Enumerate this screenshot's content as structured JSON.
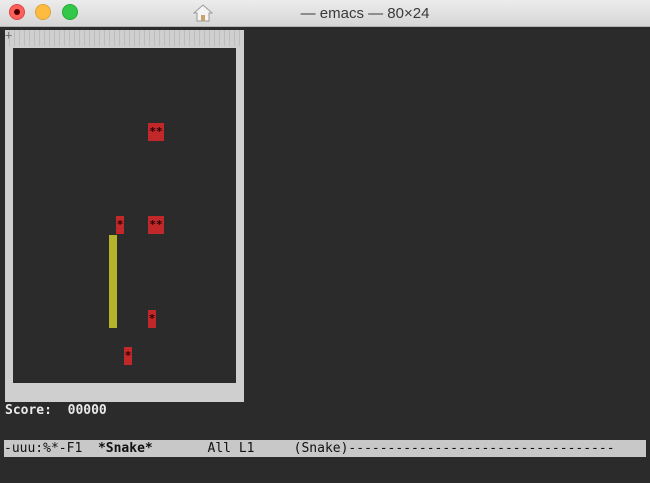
{
  "window": {
    "title": "— emacs — 80×24"
  },
  "game": {
    "corner_mark": "+",
    "score_label": "Score:",
    "score_value": "00000",
    "fruit_glyph_double": "**",
    "fruit_glyph_single": "*",
    "colors": {
      "fruit": "#c0282a",
      "snake": "#b5b22c",
      "border": "#cfcfcf",
      "background": "#2b2b2b"
    }
  },
  "modeline": {
    "status": "-uuu:%*-F1",
    "buffer": "*Snake*",
    "position": "All L1",
    "mode": "(Snake)----------------------------------"
  }
}
